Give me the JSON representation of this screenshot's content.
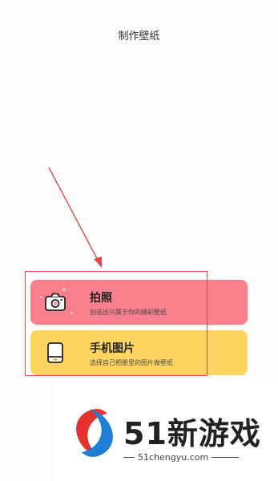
{
  "header": {
    "title": "制作壁纸"
  },
  "options": [
    {
      "label": "拍照",
      "subtitle": "创造出只属于你的精彩壁纸",
      "icon": "camera-icon",
      "color": "#fa7f8d"
    },
    {
      "label": "手机图片",
      "subtitle": "选择自己相册里的图片做壁纸",
      "icon": "phone-gallery-icon",
      "color": "#fed55e"
    }
  ],
  "annotation": {
    "color": "#e24b4b"
  },
  "watermark": {
    "brand": "51新游戏",
    "url": "51chengyu.com"
  }
}
